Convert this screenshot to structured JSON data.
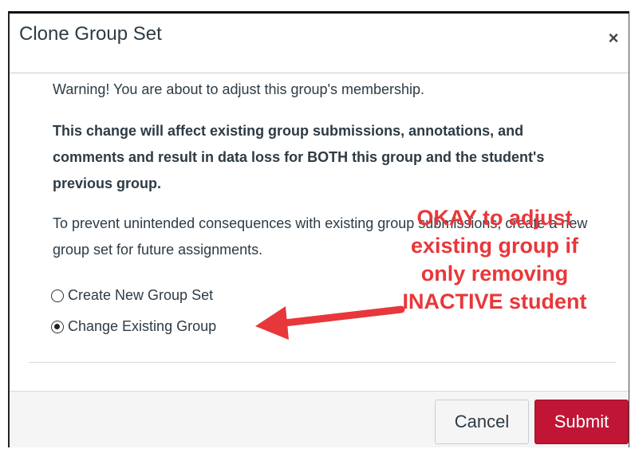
{
  "dialog": {
    "title": "Clone Group Set",
    "close_icon": "close-icon",
    "close_glyph": "×"
  },
  "body": {
    "warning": "Warning! You are about to adjust this group's membership.",
    "bold_notice": "This change will affect existing group submissions, annotations, and comments and result in data loss for BOTH this group and the student's previous group.",
    "prevent_text": "To prevent unintended consequences with existing group submissions, create a new group set for future assignments.",
    "options": [
      {
        "label": "Create New Group Set",
        "selected": false
      },
      {
        "label": "Change Existing Group",
        "selected": true
      }
    ]
  },
  "annotation": {
    "text": "OKAY to adjust existing group if only removing INACTIVE student",
    "color": "#e8373a"
  },
  "footer": {
    "cancel_label": "Cancel",
    "submit_label": "Submit",
    "submit_color": "#c01534"
  }
}
